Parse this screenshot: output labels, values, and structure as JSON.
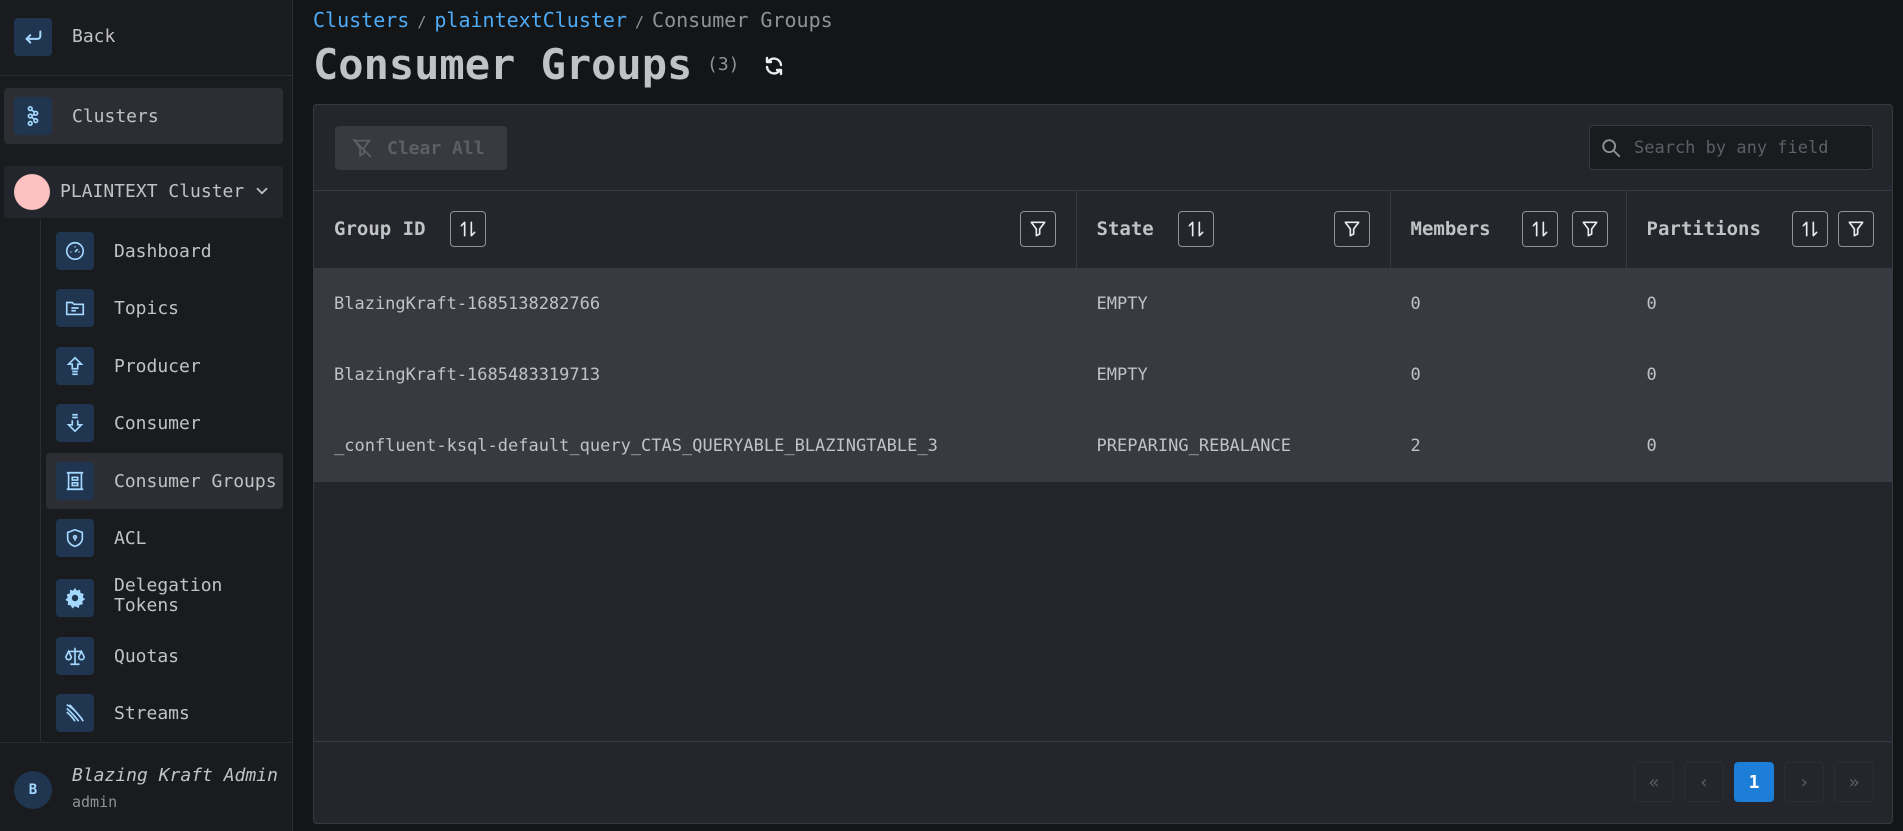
{
  "sidebar": {
    "back_label": "Back",
    "clusters_label": "Clusters",
    "cluster_name": "PLAINTEXT Cluster",
    "items": [
      {
        "label": "Dashboard",
        "icon": "gauge-icon"
      },
      {
        "label": "Topics",
        "icon": "topics-icon"
      },
      {
        "label": "Producer",
        "icon": "producer-icon"
      },
      {
        "label": "Consumer",
        "icon": "consumer-icon"
      },
      {
        "label": "Consumer Groups",
        "icon": "consumer-groups-icon",
        "active": true
      },
      {
        "label": "ACL",
        "icon": "shield-icon"
      },
      {
        "label": "Delegation Tokens",
        "icon": "gear-icon"
      },
      {
        "label": "Quotas",
        "icon": "scale-icon"
      },
      {
        "label": "Streams",
        "icon": "streams-icon"
      }
    ],
    "user": {
      "initial": "B",
      "name": "Blazing Kraft Admin",
      "role": "admin"
    }
  },
  "breadcrumb": {
    "clusters": "Clusters",
    "cluster": "plaintextCluster",
    "current": "Consumer Groups",
    "sep": "/"
  },
  "page": {
    "title": "Consumer Groups",
    "count": "(3)"
  },
  "toolbar": {
    "clear_label": "Clear All",
    "search_placeholder": "Search by any field"
  },
  "table": {
    "columns": [
      "Group ID",
      "State",
      "Members",
      "Partitions"
    ],
    "rows": [
      {
        "group_id": "BlazingKraft-1685138282766",
        "state": "EMPTY",
        "members": "0",
        "partitions": "0"
      },
      {
        "group_id": "BlazingKraft-1685483319713",
        "state": "EMPTY",
        "members": "0",
        "partitions": "0"
      },
      {
        "group_id": "_confluent-ksql-default_query_CTAS_QUERYABLE_BLAZINGTABLE_3",
        "state": "PREPARING_REBALANCE",
        "members": "2",
        "partitions": "0"
      }
    ]
  },
  "pagination": {
    "current": "1",
    "first": "«",
    "prev": "‹",
    "next": "›",
    "last": "»"
  },
  "colors": {
    "accent": "#1c7ed6",
    "link": "#4dabf7",
    "background": "#141517",
    "sidebar": "#1a1b1e"
  }
}
